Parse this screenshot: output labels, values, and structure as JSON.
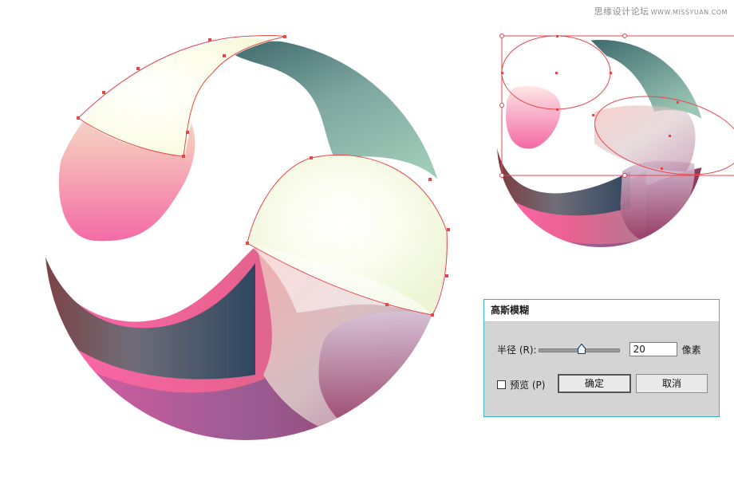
{
  "watermark": {
    "site_name": "思缘设计论坛",
    "site_url": "WWW.MISSYUAN.COM"
  },
  "dialog": {
    "title": "高斯模糊",
    "radius_label": "半径 (R):",
    "radius_value": "20",
    "radius_unit": "像素",
    "slider_fraction": 0.53,
    "preview_label": "预览 (P)",
    "preview_checked": false,
    "ok_label": "确定",
    "cancel_label": "取消"
  },
  "colors": {
    "selection": "#e8474a",
    "dialog_border": "#3bb3c3",
    "pink": "#f36aa5",
    "teal": "#5d8f89",
    "cream": "#fbfde6"
  },
  "icons": {
    "slider_thumb": "triangle-pointer-icon",
    "anchor_point": "square-anchor-icon"
  }
}
